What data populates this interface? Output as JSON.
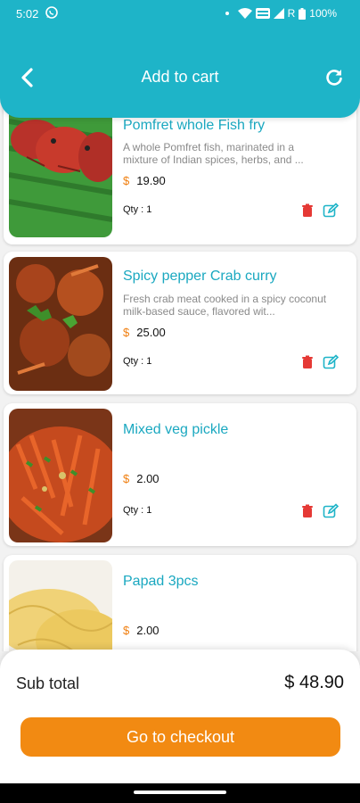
{
  "status_bar": {
    "time": "5:02",
    "battery": "100%",
    "network": "R"
  },
  "header": {
    "title": "Add to cart"
  },
  "icons": {
    "back": "chevron-left-icon",
    "refresh": "refresh-icon",
    "delete": "trash-icon",
    "edit": "edit-icon"
  },
  "colors": {
    "header": "#1eb4c8",
    "title_text": "#1aa8c0",
    "currency": "#f07f10",
    "delete": "#e53935",
    "checkout": "#f28a12"
  },
  "items": [
    {
      "name": "Pomfret whole Fish fry",
      "description": "A whole Pomfret fish, marinated in a mixture of Indian spices, herbs, and ...",
      "currency": "$",
      "price": "19.90",
      "qty": "Qty : 1"
    },
    {
      "name": "Spicy pepper Crab curry",
      "description": "Fresh crab meat cooked in a spicy coconut milk-based sauce, flavored wit...",
      "currency": "$",
      "price": "25.00",
      "qty": "Qty : 1"
    },
    {
      "name": "Mixed veg pickle",
      "description": "",
      "currency": "$",
      "price": "2.00",
      "qty": "Qty : 1"
    },
    {
      "name": "Papad 3pcs",
      "description": "",
      "currency": "$",
      "price": "2.00",
      "qty": ""
    }
  ],
  "summary": {
    "subtotal_label": "Sub total",
    "subtotal_value": "$ 48.90",
    "checkout_label": "Go to checkout"
  }
}
